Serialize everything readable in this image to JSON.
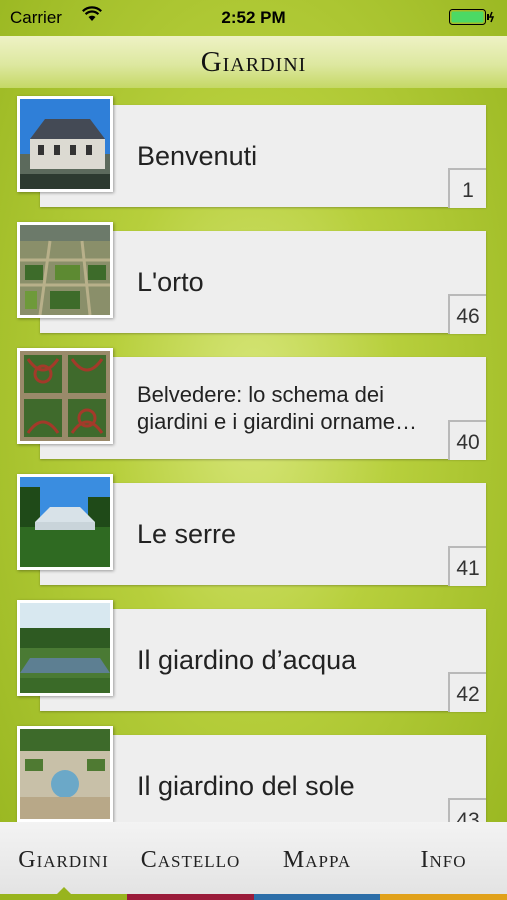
{
  "status_bar": {
    "carrier": "Carrier",
    "time": "2:52 PM"
  },
  "header": {
    "title": "Giardini"
  },
  "items": [
    {
      "title": "Benvenuti",
      "number": "1",
      "thumb_icon": "castle-photo"
    },
    {
      "title": "L'orto",
      "number": "46",
      "thumb_icon": "kitchen-garden-photo"
    },
    {
      "title_line1": "Belvedere: lo schema dei",
      "title_line2": "giardini e i giardini orname…",
      "number": "40",
      "thumb_icon": "ornamental-garden-photo"
    },
    {
      "title": "Le serre",
      "number": "41",
      "thumb_icon": "greenhouse-photo"
    },
    {
      "title": "Il giardino d’acqua",
      "number": "42",
      "thumb_icon": "water-garden-photo"
    },
    {
      "title": "Il giardino del sole",
      "number": "43",
      "thumb_icon": "sun-garden-photo"
    }
  ],
  "tabs": [
    {
      "label": "Giardini",
      "color": "#98b41e",
      "active": true
    },
    {
      "label": "Castello",
      "color": "#9a1b3a"
    },
    {
      "label": "Mappa",
      "color": "#2c6ea8"
    },
    {
      "label": "Info",
      "color": "#e1a11a"
    }
  ]
}
